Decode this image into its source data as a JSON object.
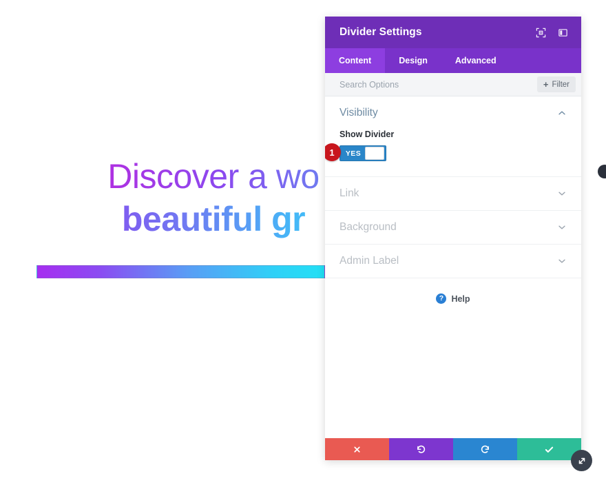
{
  "page": {
    "headline_line1": "Discover a wo",
    "headline_line2": "beautiful gr",
    "divider_gradient_start": "#a62ef0",
    "divider_gradient_end": "#22e0f5"
  },
  "modal": {
    "title": "Divider Settings",
    "header_icons": [
      {
        "name": "focus-mode-icon"
      },
      {
        "name": "dock-panel-icon"
      }
    ],
    "tabs": [
      {
        "label": "Content",
        "active": true
      },
      {
        "label": "Design",
        "active": false
      },
      {
        "label": "Advanced",
        "active": false
      }
    ],
    "search": {
      "placeholder": "Search Options",
      "value": ""
    },
    "filter_button": {
      "plus": "+",
      "label": "Filter"
    },
    "groups": [
      {
        "title": "Visibility",
        "state": "expanded",
        "chevron": "chevron-up-icon",
        "field_label": "Show Divider",
        "toggle_value": "YES",
        "badge": "1"
      },
      {
        "title": "Link",
        "state": "collapsed",
        "chevron": "chevron-down-icon"
      },
      {
        "title": "Background",
        "state": "collapsed",
        "chevron": "chevron-down-icon"
      },
      {
        "title": "Admin Label",
        "state": "collapsed",
        "chevron": "chevron-down-icon"
      }
    ],
    "help": {
      "icon_glyph": "?",
      "label": "Help"
    },
    "footer_buttons": [
      {
        "name": "cancel-button",
        "glyph": "✕",
        "color": "#e95a52"
      },
      {
        "name": "undo-button",
        "glyph": "↺",
        "color": "#7d36cf"
      },
      {
        "name": "redo-button",
        "glyph": "↻",
        "color": "#2a86d1"
      },
      {
        "name": "save-button",
        "glyph": "✔",
        "color": "#2dbd98"
      }
    ]
  },
  "colors": {
    "header_purple": "#6e2eb7",
    "tabbar_purple": "#7932ca",
    "active_tab_purple": "#8d3ee0",
    "toggle_blue": "#2a86c9",
    "badge_red": "#c8161d"
  }
}
